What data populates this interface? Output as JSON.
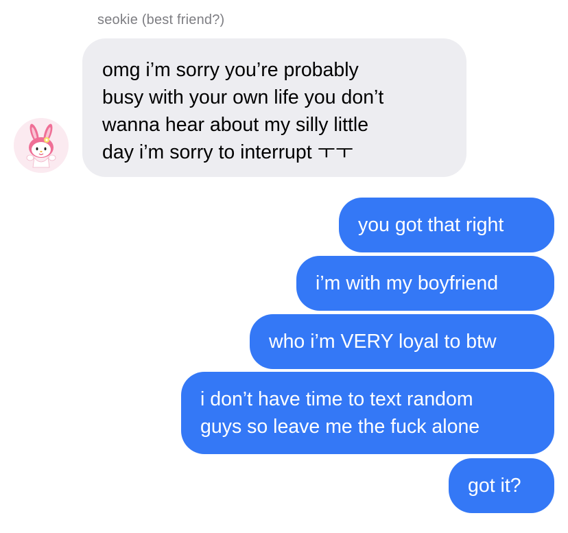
{
  "conversation": {
    "sender_name": "seokie (best friend?)",
    "avatar_icon": "my-melody-avatar-icon",
    "incoming_message": {
      "lines": [
        "omg i’m sorry you’re probably",
        "busy with your own life you don’t",
        "wanna hear about my silly little",
        "day i’m sorry to interrupt ㅜㅜ"
      ]
    },
    "outgoing_messages": [
      {
        "text": "you got that right"
      },
      {
        "text": "i’m with my boyfriend"
      },
      {
        "text": "who i’m VERY loyal to btw"
      },
      {
        "lines": [
          "i don’t have time to text random",
          "guys so leave me the fuck alone"
        ]
      },
      {
        "text": "got it?"
      }
    ]
  },
  "colors": {
    "background": "#ffffff",
    "incoming_bubble": "#ededf1",
    "outgoing_bubble": "#3478f6",
    "sender_name": "#7d7d82"
  }
}
